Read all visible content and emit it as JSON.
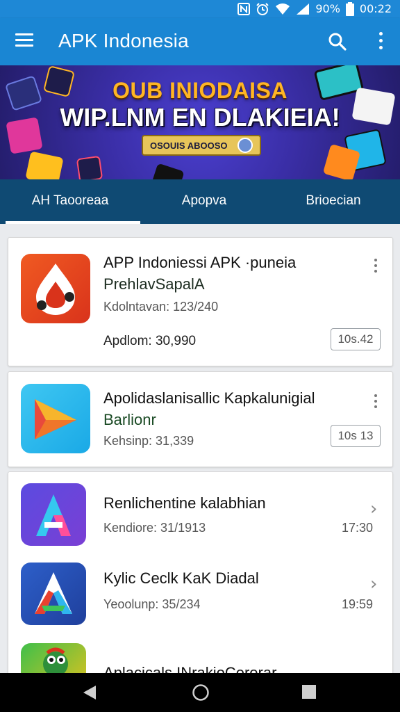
{
  "status_bar": {
    "battery": "90%",
    "time": "00:22"
  },
  "app_bar": {
    "title": "APK Indonesia"
  },
  "banner": {
    "line1": "OUB INIODAISA",
    "line2": "WIP.LNM EN DLAKIEIA!",
    "pill_text": "OSOUIS ABOOSO"
  },
  "tabs": [
    {
      "label": "AH Taooreaa"
    },
    {
      "label": "Apopva"
    },
    {
      "label": "Brioecian"
    }
  ],
  "cards": [
    {
      "name": "APP Indoniessi APK ·puneia",
      "subtitle": "PrehlavSapalA",
      "meta1": "Kdolntavan: 123/240",
      "meta2": "Apdlom: 30,990",
      "badge": "10s.42"
    },
    {
      "name": "Apolidaslanisallic Kapkalunigial",
      "subtitle": "Barlionr",
      "meta1": "Kehsinp: 31,339",
      "badge": "10s 13"
    }
  ],
  "list": [
    {
      "name": "Renlichentine kalabhian",
      "meta": "Kendiore: 31/1913",
      "time": "17:30"
    },
    {
      "name": "Kylic Ceclk KaK Diadal",
      "meta": "Yeoolunp: 35/234",
      "time": "19:59"
    },
    {
      "name": "Aplacicals INrakioCerorar",
      "meta": "",
      "time": ""
    }
  ],
  "icons": {
    "menu": "menu-icon",
    "search": "search-icon",
    "more": "more-vert-icon",
    "back": "back-icon",
    "home": "home-icon",
    "recents": "recents-icon"
  },
  "colors": {
    "primary": "#1a86d3",
    "tab_bar": "#0f4a73",
    "banner_gold": "#ffb524"
  }
}
